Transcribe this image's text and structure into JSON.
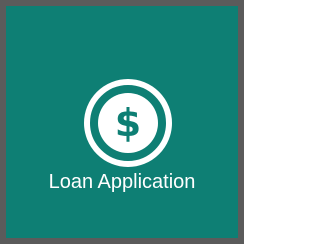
{
  "tile": {
    "label": "Loan Application",
    "icon": "dollar-circle-icon",
    "colors": {
      "background": "#0e7f74",
      "border": "#5b5b5b",
      "foreground": "#ffffff"
    }
  }
}
